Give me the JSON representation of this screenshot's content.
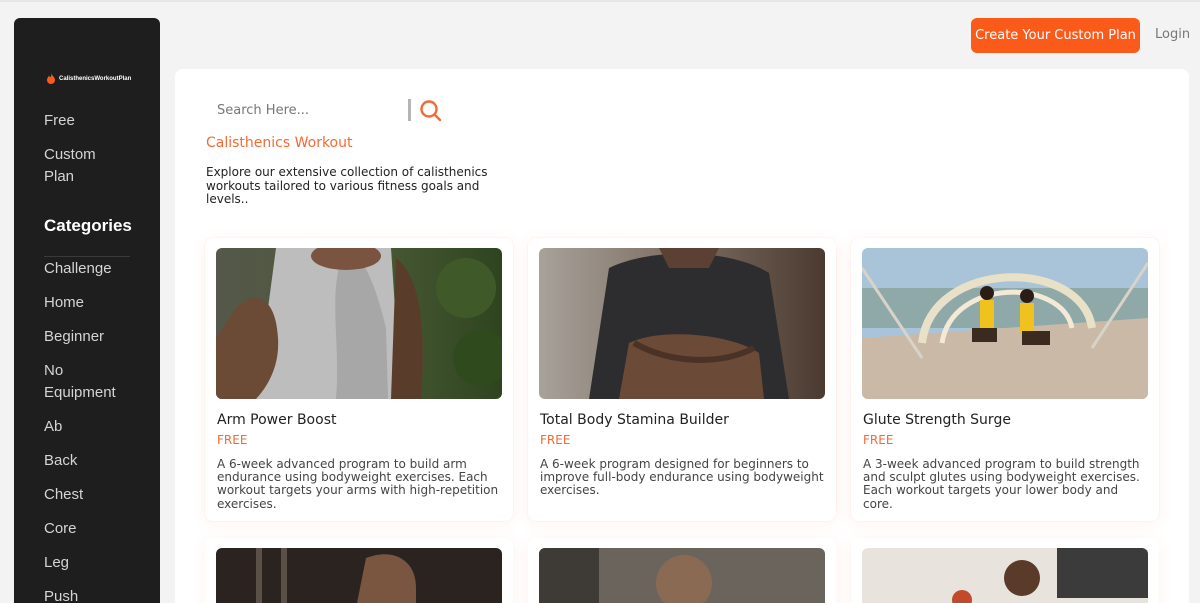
{
  "brand": {
    "name": "CalisthenicsWorkoutPlan",
    "icon": "flame-icon",
    "accent": "#fb5b1a"
  },
  "sidebar": {
    "links": [
      {
        "label": "Free"
      },
      {
        "label": "Custom Plan"
      }
    ],
    "categories_heading": "Categories",
    "categories": [
      {
        "label": "Challenge"
      },
      {
        "label": "Home"
      },
      {
        "label": "Beginner"
      },
      {
        "label": "No Equipment"
      },
      {
        "label": "Ab"
      },
      {
        "label": "Back"
      },
      {
        "label": "Chest"
      },
      {
        "label": "Core"
      },
      {
        "label": "Leg"
      },
      {
        "label": "Push"
      }
    ]
  },
  "header": {
    "cta_label": "Create Your Custom Plan",
    "login_label": "Login"
  },
  "search": {
    "placeholder": "Search Here...",
    "value": ""
  },
  "section": {
    "title": "Calisthenics Workout",
    "description": "Explore our extensive collection of calisthenics workouts tailored to various fitness goals and levels.."
  },
  "cards": [
    {
      "title": "Arm Power Boost",
      "badge": "FREE",
      "description": "A 6-week advanced program to build arm endurance using bodyweight exercises. Each workout targets your arms with high-repetition exercises."
    },
    {
      "title": "Total Body Stamina Builder",
      "badge": "FREE",
      "description": "A 6-week program designed for beginners to improve full-body endurance using bodyweight exercises."
    },
    {
      "title": "Glute Strength Surge",
      "badge": "FREE",
      "description": "A 3-week advanced program to build strength and sculpt glutes using bodyweight exercises. Each workout targets your lower body and core."
    }
  ]
}
